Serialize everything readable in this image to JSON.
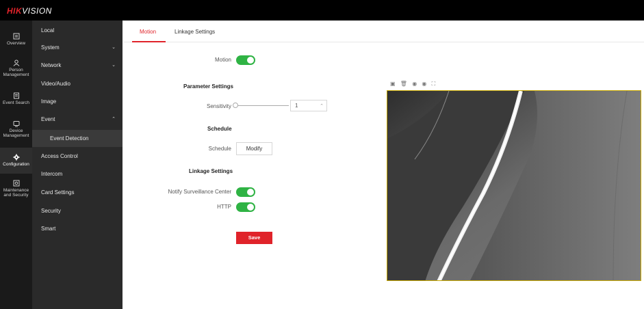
{
  "brand": {
    "logo_part1": "HIK",
    "logo_part2": "VISION",
    "accent": "#e0232a"
  },
  "nav_icons": [
    {
      "label": "Overview",
      "icon": "overview-icon"
    },
    {
      "label": "Person Management",
      "icon": "person-icon"
    },
    {
      "label": "Event Search",
      "icon": "event-search-icon"
    },
    {
      "label": "Device Management",
      "icon": "device-icon"
    },
    {
      "label": "Configuration",
      "icon": "gear-icon",
      "active": true
    },
    {
      "label": "Maintenance and Security",
      "icon": "maintenance-icon"
    }
  ],
  "menu": [
    {
      "label": "Local"
    },
    {
      "label": "System",
      "chevron": "down"
    },
    {
      "label": "Network",
      "chevron": "down"
    },
    {
      "label": "Video/Audio"
    },
    {
      "label": "Image"
    },
    {
      "label": "Event",
      "chevron": "up"
    },
    {
      "label": "Event Detection",
      "sub": true,
      "selected": true
    },
    {
      "label": "Access Control"
    },
    {
      "label": "Intercom"
    },
    {
      "label": "Card Settings"
    },
    {
      "label": "Security"
    },
    {
      "label": "Smart"
    }
  ],
  "tabs": [
    {
      "label": "Motion",
      "active": true
    },
    {
      "label": "Linkage Settings"
    }
  ],
  "form": {
    "motion_label": "Motion",
    "motion_on": true,
    "parameter_heading": "Parameter Settings",
    "sensitivity_label": "Sensitivity",
    "sensitivity_value": "1",
    "schedule_heading": "Schedule",
    "schedule_label": "Schedule",
    "modify_label": "Modify",
    "linkage_heading": "Linkage Settings",
    "notify_label": "Notify Surveillance Center",
    "notify_on": true,
    "http_label": "HTTP",
    "http_on": true,
    "save_label": "Save"
  },
  "video_tools": [
    "aspect-ratio-icon",
    "delete-icon",
    "snapshot-icon",
    "record-icon",
    "fullscreen-icon"
  ],
  "colors": {
    "toggle_on": "#2fb344",
    "save": "#e0232a",
    "video_border": "#c8a800"
  }
}
